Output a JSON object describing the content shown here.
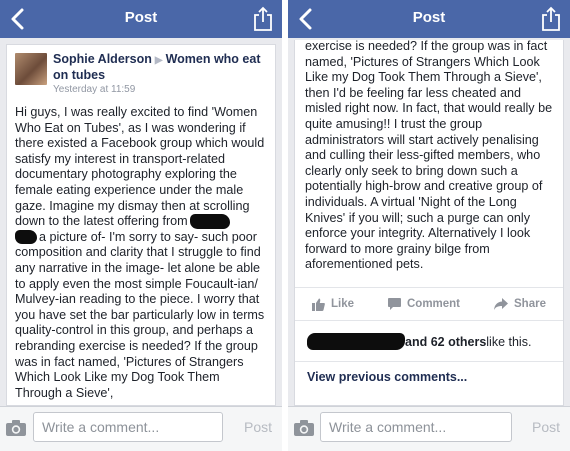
{
  "left": {
    "nav": {
      "title": "Post"
    },
    "post": {
      "author": "Sophie Alderson",
      "group": "Women who eat on tubes",
      "timestamp": "Yesterday at 11:59",
      "text_part1": "Hi guys, I was really excited to find 'Women Who Eat on Tubes', as I was wondering if there existed a Facebook group which would satisfy my interest in transport-related documentary photography exploring the female eating experience under the male gaze. Imagine my dismay then at scrolling down to the latest offering from",
      "text_part2": "a picture of- I'm sorry to say- such poor composition and clarity that I struggle to find any narrative in the image- let alone be able to apply even the most simple Foucault-ian/ Mulvey-ian reading to the piece. I worry that you have set the bar particularly low in terms quality-control in this group, and perhaps a rebranding exercise is needed? If the group was in fact named, 'Pictures of Strangers Which Look Like my Dog Took Them Through a Sieve',"
    },
    "composer": {
      "placeholder": "Write a comment...",
      "post_label": "Post"
    }
  },
  "right": {
    "nav": {
      "title": "Post"
    },
    "post": {
      "text": "exercise is needed? If the group was in fact named, 'Pictures of Strangers Which Look Like my Dog Took Them Through a Sieve', then I'd be feeling far less cheated and misled right now. In fact, that would really be quite amusing!! I trust the group administrators will start actively penalising and culling their less-gifted members, who clearly only seek to bring down such a potentially high-brow and creative group of individuals. A virtual 'Night of the Long Knives' if you will; such a purge can only enforce your integrity. Alternatively I look forward to more grainy bilge from aforementioned pets."
    },
    "actions": {
      "like": "Like",
      "comment": "Comment",
      "share": "Share"
    },
    "likes": {
      "count_text": "and 62 others",
      "suffix": " like this."
    },
    "previous_comments": "View previous comments...",
    "composer": {
      "placeholder": "Write a comment...",
      "post_label": "Post"
    }
  },
  "icons": {
    "back": "chevron-left-icon",
    "share": "share-upload-icon",
    "camera": "camera-icon",
    "like": "thumbs-up-icon",
    "comment": "speech-bubble-icon",
    "share_action": "share-arrow-icon"
  },
  "colors": {
    "navbar": "#4a67a8",
    "link": "#1f2d52",
    "background": "#e9eaee"
  }
}
